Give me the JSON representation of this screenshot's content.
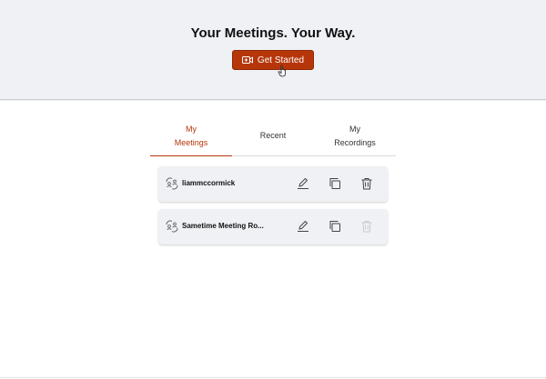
{
  "hero": {
    "title": "Your Meetings. Your Way.",
    "cta_label": "Get Started",
    "cta_icon": "video-camera-plus-icon"
  },
  "tabs": [
    {
      "label": "My\nMeetings",
      "active": true
    },
    {
      "label": "Recent",
      "active": false
    },
    {
      "label": "My\nRecordings",
      "active": false
    }
  ],
  "meetings": [
    {
      "name": "liammccormick",
      "delete_enabled": true
    },
    {
      "name": "Sametime Meeting Ro...",
      "delete_enabled": false
    }
  ],
  "colors": {
    "accent": "#b6360a",
    "hero_bg": "#eff1f5",
    "card_bg": "#eff1f4"
  }
}
